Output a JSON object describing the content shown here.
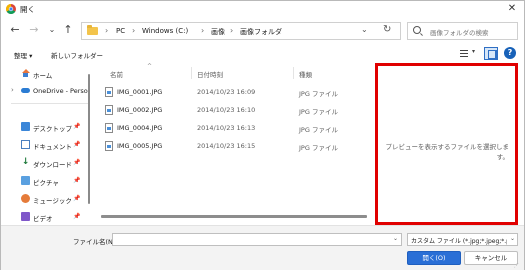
{
  "window": {
    "title": "開く",
    "close_glyph": "✕"
  },
  "nav": {
    "back": "←",
    "forward": "→",
    "recent": "⌄",
    "up": "↑"
  },
  "address": {
    "crumbs": [
      "PC",
      "Windows (C:)",
      "画像",
      "画像フォルダ"
    ],
    "separator": "›",
    "dropdown": "⌄",
    "refresh": "↻"
  },
  "search": {
    "placeholder": "画像フォルダの検索"
  },
  "toolbar": {
    "organize": "整理 ▾",
    "new_folder": "新しいフォルダー",
    "view_dropdown": "▾",
    "help": "?"
  },
  "sidebar": {
    "items": [
      {
        "label": "ホーム",
        "icon": "home-icon",
        "expander": "",
        "pin": ""
      },
      {
        "label": "OneDrive - Perso",
        "icon": "onedrive-cloud-icon",
        "expander": "›",
        "pin": ""
      },
      {
        "label": "デスクトップ",
        "icon": "desktop-icon",
        "expander": "",
        "pin": "📌"
      },
      {
        "label": "ドキュメント",
        "icon": "document-icon",
        "expander": "",
        "pin": "📌"
      },
      {
        "label": "ダウンロード",
        "icon": "download-icon",
        "expander": "",
        "pin": "📌"
      },
      {
        "label": "ピクチャ",
        "icon": "pictures-icon",
        "expander": "",
        "pin": "📌"
      },
      {
        "label": "ミュージック",
        "icon": "music-icon",
        "expander": "",
        "pin": "📌"
      },
      {
        "label": "ビデオ",
        "icon": "video-icon",
        "expander": "",
        "pin": "📌"
      }
    ],
    "download_glyph": "↓"
  },
  "filelist": {
    "columns": {
      "name": "名前",
      "date": "日付時刻",
      "type": "種類"
    },
    "sort_indicator": "^",
    "files": [
      {
        "name": "IMG_0001.JPG",
        "date": "2014/10/23 16:09",
        "type": "JPG ファイル"
      },
      {
        "name": "IMG_0002.JPG",
        "date": "2014/10/23 16:10",
        "type": "JPG ファイル"
      },
      {
        "name": "IMG_0004.JPG",
        "date": "2014/10/23 16:13",
        "type": "JPG ファイル"
      },
      {
        "name": "IMG_0005.JPG",
        "date": "2014/10/23 16:15",
        "type": "JPG ファイル"
      }
    ]
  },
  "preview": {
    "message": "プレビューを表示するファイルを選択します。",
    "highlight_color": "#e00000"
  },
  "bottom": {
    "filename_label": "ファイル名(N):",
    "filename_value": "",
    "filename_dropdown": "⌄",
    "filetype_value": "カスタム ファイル (*.jpg;*.jpeg;*.png",
    "filetype_dropdown": "⌄",
    "open_button": "開く(O)",
    "cancel_button": "キャンセル"
  },
  "colors": {
    "accent": "#2a6fd6"
  }
}
